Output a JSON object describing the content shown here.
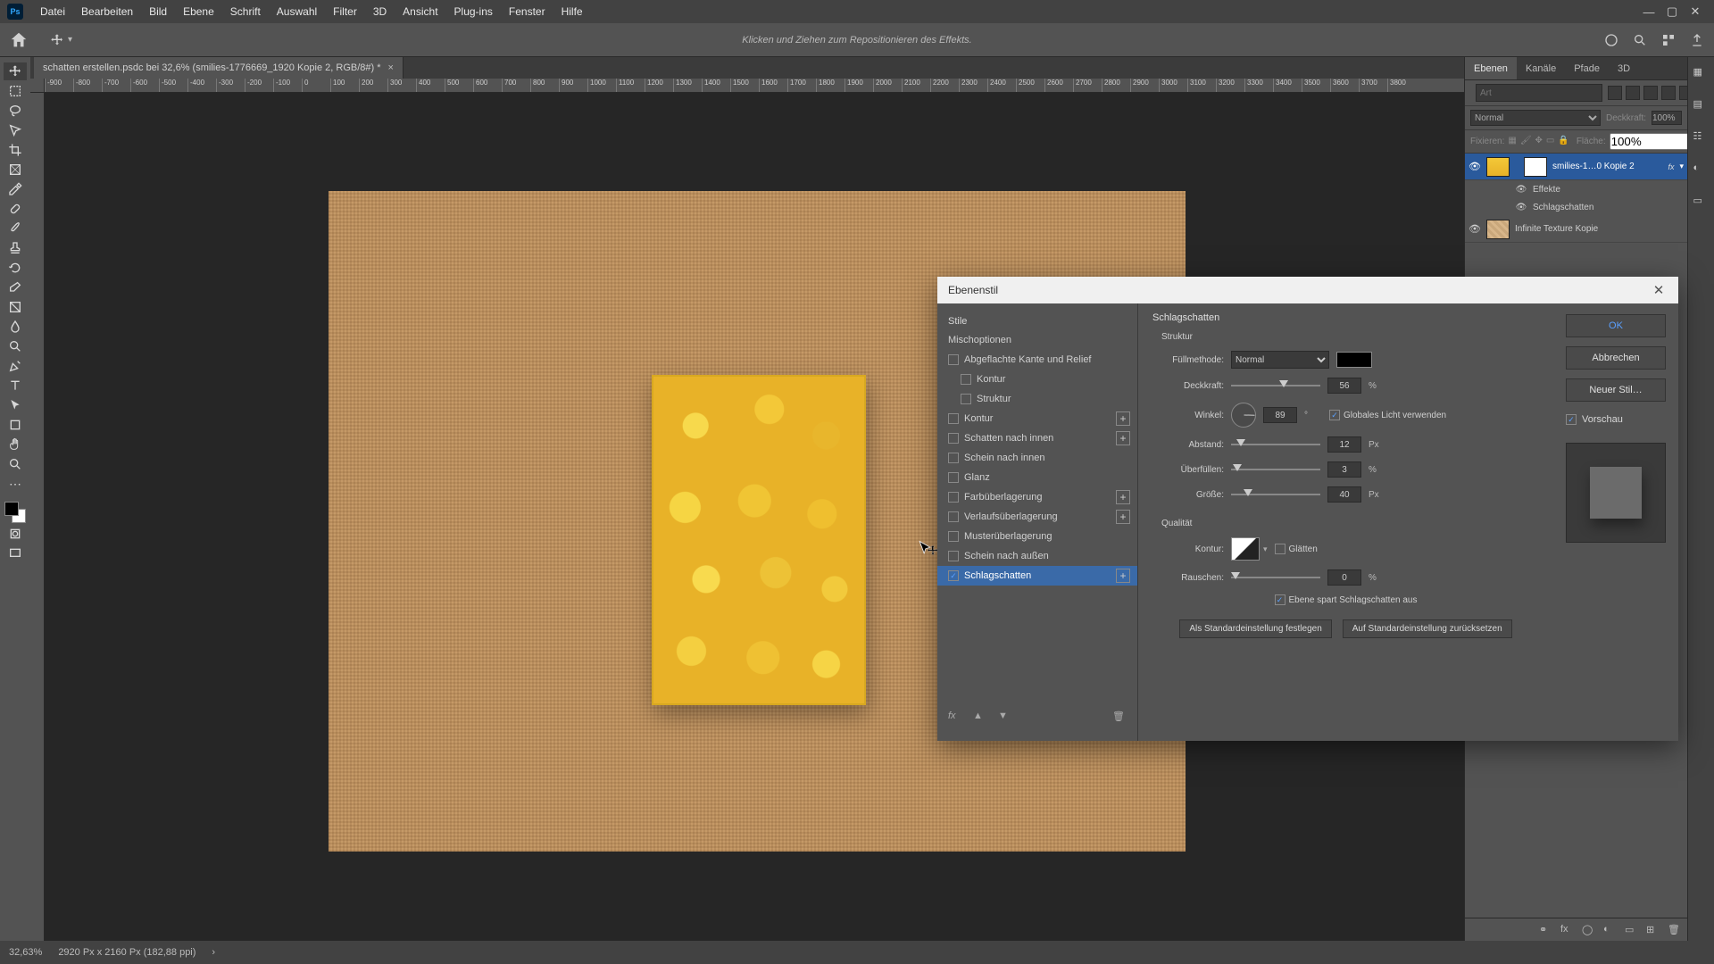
{
  "menu": {
    "items": [
      "Datei",
      "Bearbeiten",
      "Bild",
      "Ebene",
      "Schrift",
      "Auswahl",
      "Filter",
      "3D",
      "Ansicht",
      "Plug-ins",
      "Fenster",
      "Hilfe"
    ]
  },
  "options_bar": {
    "hint": "Klicken und Ziehen zum Repositionieren des Effekts."
  },
  "document": {
    "tab_title": "schatten erstellen.psdc bei 32,6% (smilies-1776669_1920 Kopie 2, RGB/8#) *"
  },
  "ruler_ticks": [
    "-900",
    "-800",
    "-700",
    "-600",
    "-500",
    "-400",
    "-300",
    "-200",
    "-100",
    "0",
    "100",
    "200",
    "300",
    "400",
    "500",
    "600",
    "700",
    "800",
    "900",
    "1000",
    "1100",
    "1200",
    "1300",
    "1400",
    "1500",
    "1600",
    "1700",
    "1800",
    "1900",
    "2000",
    "2100",
    "2200",
    "2300",
    "2400",
    "2500",
    "2600",
    "2700",
    "2800",
    "2900",
    "3000",
    "3100",
    "3200",
    "3300",
    "3400",
    "3500",
    "3600",
    "3700",
    "3800"
  ],
  "panels": {
    "tabs": {
      "layers": "Ebenen",
      "channels": "Kanäle",
      "paths": "Pfade",
      "threeD": "3D"
    },
    "search_placeholder": "Art",
    "blend_mode": "Normal",
    "opacity_label": "Deckkraft:",
    "opacity_value": "100%",
    "lock_label": "Fixieren:",
    "fill_label": "Fläche:",
    "fill_value": "100%",
    "layers": [
      {
        "name": "smilies-1…0 Kopie 2",
        "fx": "fx",
        "selected": true
      },
      {
        "name": "Infinite Texture Kopie",
        "selected": false
      }
    ],
    "effects_label": "Effekte",
    "effect_dropshadow": "Schlagschatten"
  },
  "status": {
    "zoom": "32,63%",
    "doc_info": "2920 Px x 2160 Px (182,88 ppi)"
  },
  "dialog": {
    "title": "Ebenenstil",
    "styles_header": "Stile",
    "blend_options": "Mischoptionen",
    "style_list": [
      {
        "key": "bevel",
        "label": "Abgeflachte Kante und Relief",
        "checkbox": true,
        "checked": false
      },
      {
        "key": "contour_sub",
        "label": "Kontur",
        "indent": true,
        "checkbox": true,
        "checked": false
      },
      {
        "key": "texture_sub",
        "label": "Struktur",
        "indent": true,
        "checkbox": true,
        "checked": false
      },
      {
        "key": "stroke",
        "label": "Kontur",
        "checkbox": true,
        "checked": false,
        "plus": true
      },
      {
        "key": "inner_shadow",
        "label": "Schatten nach innen",
        "checkbox": true,
        "checked": false,
        "plus": true
      },
      {
        "key": "inner_glow",
        "label": "Schein nach innen",
        "checkbox": true,
        "checked": false
      },
      {
        "key": "satin",
        "label": "Glanz",
        "checkbox": true,
        "checked": false
      },
      {
        "key": "color_overlay",
        "label": "Farbüberlagerung",
        "checkbox": true,
        "checked": false,
        "plus": true
      },
      {
        "key": "grad_overlay",
        "label": "Verlaufsüberlagerung",
        "checkbox": true,
        "checked": false,
        "plus": true
      },
      {
        "key": "pattern_overlay",
        "label": "Musterüberlagerung",
        "checkbox": true,
        "checked": false
      },
      {
        "key": "outer_glow",
        "label": "Schein nach außen",
        "checkbox": true,
        "checked": false
      },
      {
        "key": "drop_shadow",
        "label": "Schlagschatten",
        "checkbox": true,
        "checked": true,
        "plus": true,
        "selected": true
      }
    ],
    "settings": {
      "heading": "Schlagschatten",
      "structure": "Struktur",
      "blend_mode_label": "Füllmethode:",
      "blend_mode_value": "Normal",
      "opacity_label": "Deckkraft:",
      "opacity_value": "56",
      "opacity_unit": "%",
      "angle_label": "Winkel:",
      "angle_value": "89",
      "angle_unit": "°",
      "global_light": "Globales Licht verwenden",
      "distance_label": "Abstand:",
      "distance_value": "12",
      "distance_unit": "Px",
      "spread_label": "Überfüllen:",
      "spread_value": "3",
      "spread_unit": "%",
      "size_label": "Größe:",
      "size_value": "40",
      "size_unit": "Px",
      "quality": "Qualität",
      "contour_label": "Kontur:",
      "antialias": "Glätten",
      "noise_label": "Rauschen:",
      "noise_value": "0",
      "noise_unit": "%",
      "knockout": "Ebene spart Schlagschatten aus",
      "make_default": "Als Standardeinstellung festlegen",
      "reset_default": "Auf Standardeinstellung zurücksetzen"
    },
    "buttons": {
      "ok": "OK",
      "cancel": "Abbrechen",
      "new_style": "Neuer Stil…",
      "preview": "Vorschau"
    }
  }
}
